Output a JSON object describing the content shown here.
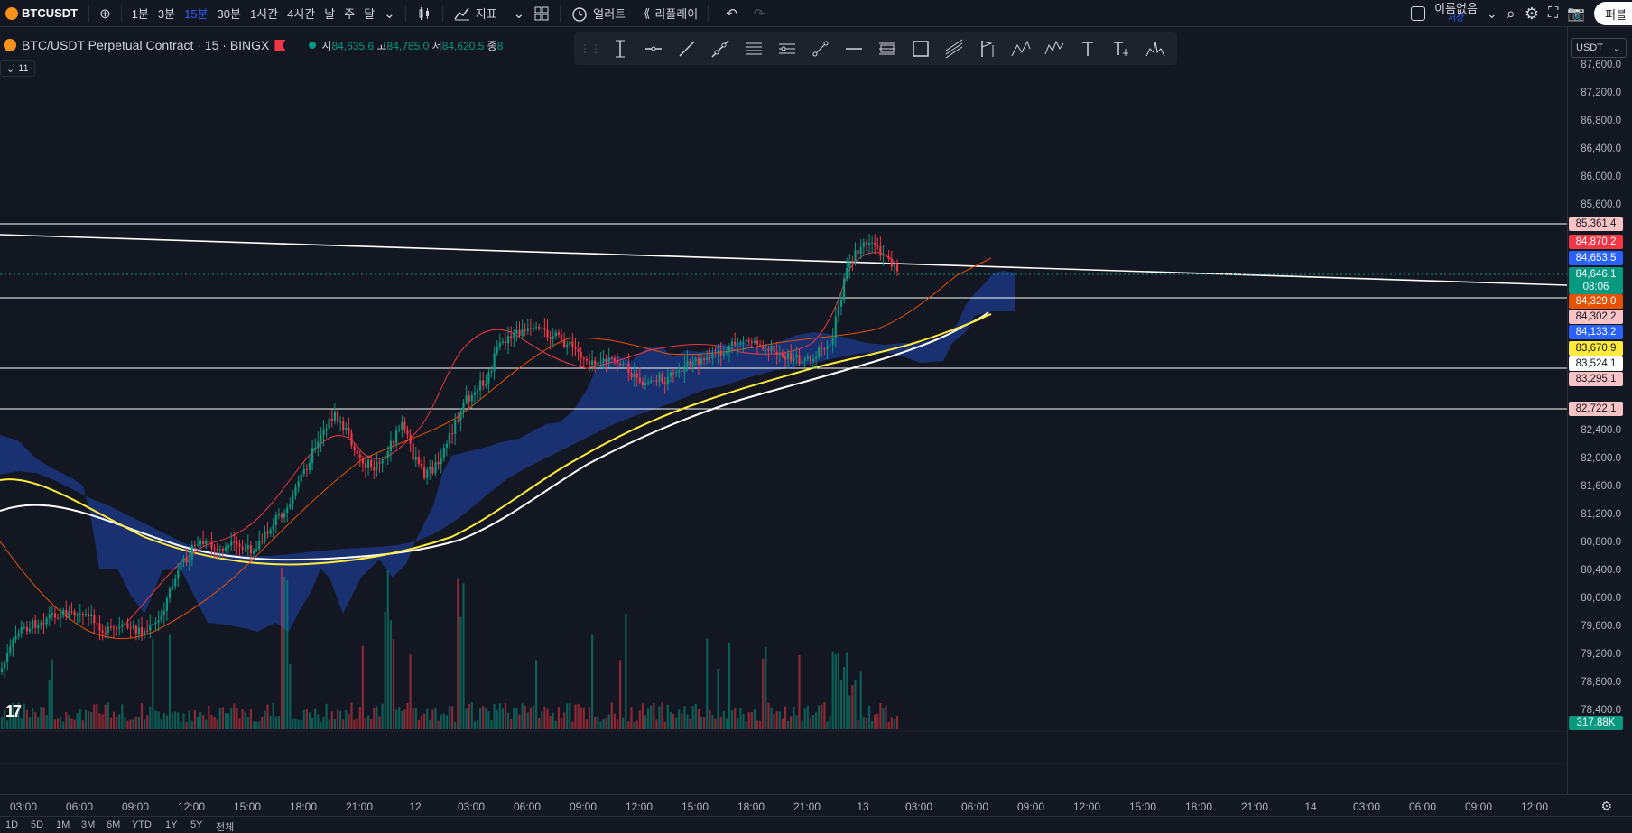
{
  "toolbar": {
    "symbol": "BTCUSDT",
    "intervals": [
      "1분",
      "3분",
      "15분",
      "30분",
      "1시간",
      "4시간",
      "날",
      "주",
      "달"
    ],
    "active_interval": "15분",
    "indicators_label": "지표",
    "alert_label": "얼러트",
    "replay_label": "리플레이",
    "layout_name": "이름없음",
    "layout_saved": "저장",
    "publish_label": "퍼블"
  },
  "legend": {
    "title": "BTC/USDT Perpetual Contract · 15 · BINGX",
    "open_label": "시",
    "open_value": "84,635.6",
    "high_label": "고",
    "high_value": "84,785.0",
    "low_label": "저",
    "low_value": "84,620.5",
    "close_label": "종",
    "close_value": "8",
    "collapse_count": "11"
  },
  "drawing_tools": [
    "cursor-line-icon",
    "horizontal-ray-icon",
    "trend-line-icon",
    "extended-line-icon",
    "parallel-channel-icon",
    "pitchfork-icon",
    "info-line-icon",
    "horizontal-line-icon",
    "fib-retracement-icon",
    "rectangle-icon",
    "gann-fan-icon",
    "flag-icon",
    "abcd-pattern-icon",
    "elliott-wave-icon",
    "text-icon",
    "text-note-icon",
    "head-shoulders-icon"
  ],
  "price_scale": {
    "currency": "USDT",
    "labels": [
      "87,600.0",
      "87,200.0",
      "86,800.0",
      "86,400.0",
      "86,000.0",
      "85,600.0",
      "82,400.0",
      "82,000.0",
      "81,600.0",
      "81,200.0",
      "80,800.0",
      "80,400.0",
      "80,000.0",
      "79,600.0",
      "79,200.0",
      "78,800.0",
      "78,400.0"
    ],
    "tags": [
      {
        "text": "85,361.4",
        "bg": "#f8c3c4",
        "fg": "#131722"
      },
      {
        "text": "84,870.2",
        "bg": "#f23645",
        "fg": "#ffffff"
      },
      {
        "text": "84,653.5",
        "bg": "#2962ff",
        "fg": "#ffffff"
      },
      {
        "text": "84,646.1",
        "bg": "#089981",
        "fg": "#ffffff"
      },
      {
        "text": "08:06",
        "bg": "#089981",
        "fg": "#ffffff"
      },
      {
        "text": "84,329.0",
        "bg": "#e65100",
        "fg": "#ffffff"
      },
      {
        "text": "84,302.2",
        "bg": "#f8c3c4",
        "fg": "#131722"
      },
      {
        "text": "84,133.2",
        "bg": "#2962ff",
        "fg": "#ffffff"
      },
      {
        "text": "83,670.9",
        "bg": "#ffeb3b",
        "fg": "#131722"
      },
      {
        "text": "83,524.1",
        "bg": "#ffffff",
        "fg": "#131722"
      },
      {
        "text": "83,295.1",
        "bg": "#f8c3c4",
        "fg": "#131722"
      },
      {
        "text": "82,722.1",
        "bg": "#f8c3c4",
        "fg": "#131722"
      },
      {
        "text": "317.88K",
        "bg": "#089981",
        "fg": "#ffffff"
      }
    ]
  },
  "time_scale": {
    "labels": [
      "03:00",
      "06:00",
      "09:00",
      "12:00",
      "15:00",
      "18:00",
      "21:00",
      "12",
      "03:00",
      "06:00",
      "09:00",
      "12:00",
      "15:00",
      "18:00",
      "21:00",
      "13",
      "03:00",
      "06:00",
      "09:00",
      "12:00",
      "15:00",
      "18:00",
      "21:00",
      "14",
      "03:00",
      "06:00",
      "09:00",
      "12:00"
    ]
  },
  "bottom_bar": {
    "ranges": [
      "1D",
      "5D",
      "1M",
      "3M",
      "6M",
      "YTD",
      "1Y",
      "5Y",
      "전체"
    ]
  },
  "colors": {
    "up": "#089981",
    "down": "#f23645",
    "cloud": "#1c3a8c",
    "ma_yellow": "#ffeb3b",
    "ma_white": "#ffffff",
    "ma_red": "#f23645",
    "ma_orange": "#e65100"
  }
}
